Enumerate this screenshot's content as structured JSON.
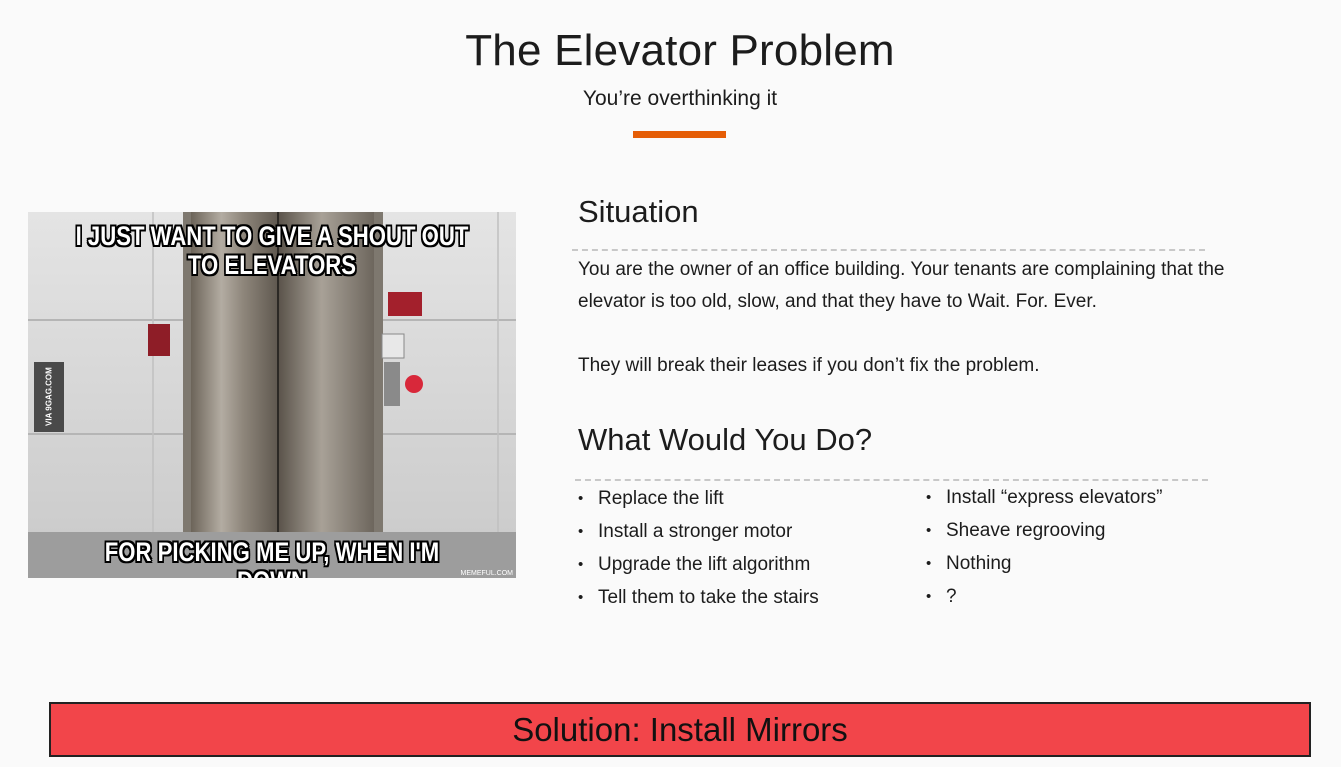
{
  "slide": {
    "title": "The Elevator Problem",
    "subtitle": "You’re overthinking it",
    "accent_color": "#e55d06"
  },
  "meme": {
    "top_caption": "I JUST WANT TO GIVE A SHOUT OUT TO ELEVATORS",
    "bottom_caption": "FOR PICKING ME UP, WHEN I'M DOWN",
    "side_watermark": "VIA 9GAG.COM",
    "corner_watermark": "MEMEFUL.COM"
  },
  "situation": {
    "heading": "Situation",
    "paragraph1": "You are the owner of an office building. Your tenants are complaining that the elevator is too old, slow, and that they have to Wait. For. Ever.",
    "paragraph2": "They will break their leases if you don’t fix the problem."
  },
  "question": {
    "heading": "What Would You Do?",
    "options_left": [
      "Replace the lift",
      "Install a stronger motor",
      "Upgrade the lift algorithm",
      "Tell them to take the stairs"
    ],
    "options_right": [
      "Install “express elevators”",
      "Sheave regrooving",
      "Nothing",
      "?"
    ]
  },
  "solution": {
    "label": "Solution: Install Mirrors",
    "color": "#f2454a"
  }
}
